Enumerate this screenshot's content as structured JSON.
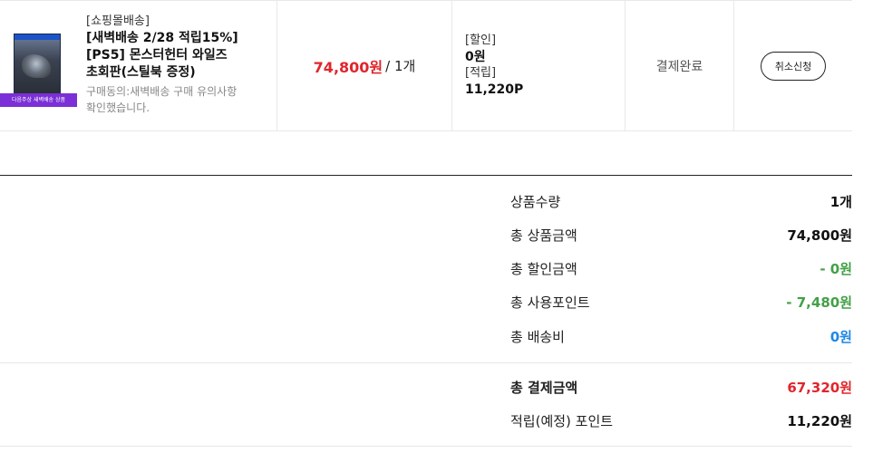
{
  "order": {
    "thumbnail_ribbon": "다음주상 새벽배송 상품",
    "mall_tag": "[쇼핑몰배송]",
    "product_name_lines": [
      "[새벽배송 2/28 적립15%]",
      "[PS5] 몬스터헌터 와일즈",
      "초회판(스틸북 증정)"
    ],
    "note_lines": [
      "구매동의:새벽배송 구매 유의사항",
      "확인했습니다."
    ],
    "price": "74,800원",
    "quantity": "/ 1개",
    "discount_label": "[할인]",
    "discount_value": "0원",
    "point_label": "[적립]",
    "point_value": "11,220P",
    "status": "결제완료",
    "cancel_label": "취소신청"
  },
  "summary": {
    "rows": [
      {
        "label": "상품수량",
        "value": "1개"
      },
      {
        "label": "총 상품금액",
        "value": "74,800원"
      },
      {
        "label": "총 할인금액",
        "value": "- 0원"
      },
      {
        "label": "총 사용포인트",
        "value": "- 7,480원"
      },
      {
        "label": "총 배송비",
        "value": "0원"
      }
    ],
    "total_label": "총 결제금액",
    "total_value": "67,320원",
    "earn_label": "적립(예정) 포인트",
    "earn_value": "11,220원"
  },
  "colors": {
    "price_red": "#e0262b",
    "discount_green": "#43a047",
    "shipping_blue": "#1e88e5",
    "ribbon_purple": "#7b2fd6"
  }
}
